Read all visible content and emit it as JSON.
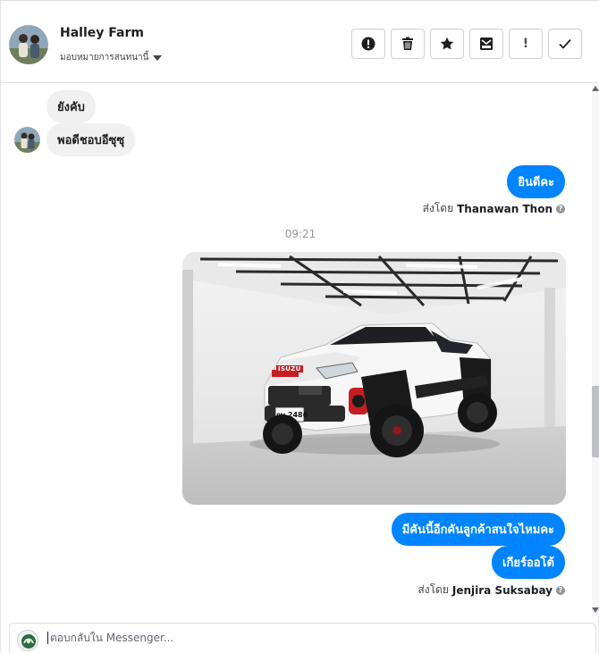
{
  "header": {
    "page_name": "Halley Farm",
    "assign_label": "มอบหมายการสนทนานี้",
    "actions": [
      {
        "name": "mark-spam-button",
        "icon": "alert-circle-icon"
      },
      {
        "name": "delete-button",
        "icon": "trash-icon"
      },
      {
        "name": "star-button",
        "icon": "star-icon"
      },
      {
        "name": "move-to-done-button",
        "icon": "inbox-icon"
      },
      {
        "name": "follow-up-button",
        "icon": "exclamation-icon",
        "label": "!"
      },
      {
        "name": "mark-done-button",
        "icon": "checkmark-icon"
      }
    ]
  },
  "thread": {
    "incoming": [
      {
        "text": "ยังคับ"
      },
      {
        "text": "พอดีชอบอีซุซุ"
      }
    ],
    "outgoing_1": {
      "text": "ยินดีคะ",
      "sent_by_prefix": "ส่งโดย",
      "sent_by_name": "Thanawan Thon"
    },
    "timestamp": "09:21",
    "photo_alt": "ISUZU",
    "photo_plate": "กษ 2486",
    "outgoing_2": [
      {
        "text": "มีคันนี้อีกคันลูกค้าสนใจไหมคะ"
      },
      {
        "text": "เกียร์ออโต้"
      }
    ],
    "sent_by_2": {
      "prefix": "ส่งโดย",
      "name": "Jenjira Suksabay"
    },
    "info_glyph": "?"
  },
  "composer": {
    "placeholder": "ตอบกลับใน Messenger..."
  },
  "colors": {
    "accent": "#0084ff",
    "incoming_bubble": "#f1f0f0"
  }
}
